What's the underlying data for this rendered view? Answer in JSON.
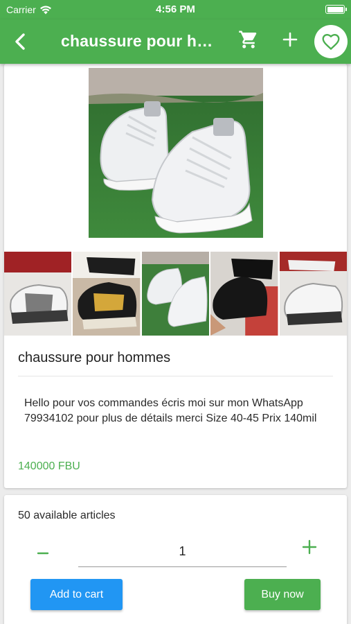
{
  "status_bar": {
    "carrier": "Carrier",
    "time": "4:56 PM"
  },
  "app_bar": {
    "title": "chaussure pour hommes",
    "icons": [
      "back-arrow-icon",
      "cart-icon",
      "plus-icon",
      "heart-icon"
    ]
  },
  "product": {
    "name": "chaussure pour hommes",
    "description": "Hello pour vos commandes écris moi sur mon WhatsApp 79934102 pour plus de détails merci Size 40-45 Prix 140mil",
    "price": "140000 FBU",
    "thumbnail_count": 5
  },
  "purchase": {
    "available": "50 available articles",
    "quantity": "1",
    "add_to_cart_label": "Add to cart",
    "buy_now_label": "Buy now"
  },
  "colors": {
    "primary_green": "#4caf50",
    "button_blue": "#2196f3",
    "background": "#ececec"
  }
}
